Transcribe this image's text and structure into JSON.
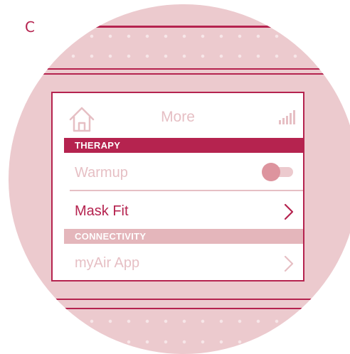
{
  "figure_label": "C",
  "header": {
    "title": "More"
  },
  "sections": [
    {
      "title": "THERAPY"
    },
    {
      "title": "CONNECTIVITY"
    }
  ],
  "rows": [
    {
      "label": "Warmup",
      "control": "toggle",
      "toggle_on": false
    },
    {
      "label": "Mask Fit",
      "control": "chevron"
    },
    {
      "label": "myAir App",
      "control": "chevron"
    }
  ],
  "icons": {
    "home": "home-icon",
    "signal": "signal-strength-icon",
    "chevron": "chevron-right-icon"
  },
  "colors": {
    "accent": "#b5234f",
    "disc_background": "#eccace",
    "inactive_text": "#e6bfc4",
    "section_secondary": "#e4b6bb",
    "toggle_knob": "#dd949e"
  }
}
